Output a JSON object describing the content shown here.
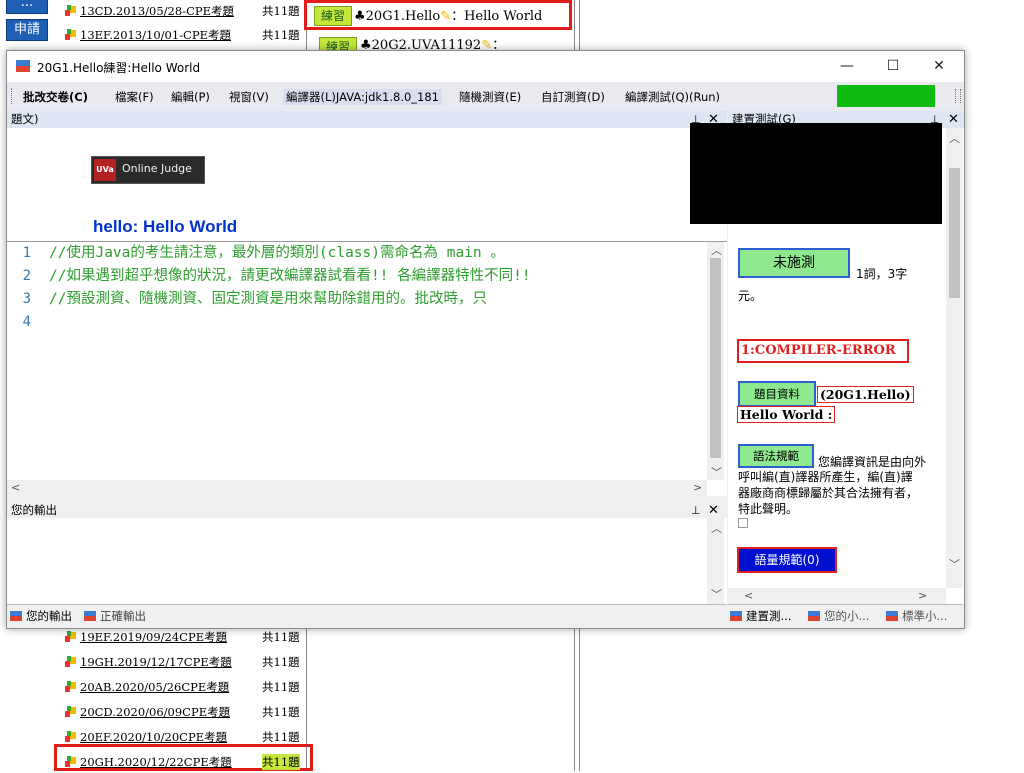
{
  "background": {
    "tags": [
      "...",
      "申請"
    ],
    "top_rows": [
      {
        "link": "13CD.2013/05/28-CPE考題",
        "count": "共11題"
      },
      {
        "link": "13EF.2013/10/01-CPE考題",
        "count": "共11題"
      }
    ],
    "practice_rows": [
      {
        "badge": "練習",
        "text": "20G1.Hello",
        "suffix": "：Hello World"
      },
      {
        "badge": "練習",
        "text": "20G2.UVA11192",
        "suffix": "："
      }
    ],
    "bottom_rows": [
      {
        "link": "19EF.2019/09/24CPE考題",
        "count": "共11題"
      },
      {
        "link": "19GH.2019/12/17CPE考題",
        "count": "共11題"
      },
      {
        "link": "20AB.2020/05/26CPE考題",
        "count": "共11題"
      },
      {
        "link": "20CD.2020/06/09CPE考題",
        "count": "共11題"
      },
      {
        "link": "20EF.2020/10/20CPE考題",
        "count": "共11題"
      },
      {
        "link": "20GH.2020/12/22CPE考題",
        "count": "共11題"
      }
    ]
  },
  "window": {
    "title": "20G1.Hello練習:Hello World",
    "controls": {
      "minimize": "—",
      "maximize": "☐",
      "close": "✕"
    }
  },
  "menu": {
    "items": [
      "批改交卷(C)",
      "檔案(F)",
      "編輯(P)",
      "視窗(V)",
      "編譯器(L)JAVA:jdk1.8.0_181",
      "隨機測資(E)",
      "自訂測資(D)",
      "編譯測試(Q)(Run)"
    ],
    "run_color": "#10bb10"
  },
  "problem_pane": {
    "header": "題文)",
    "logo_tag": "UVa",
    "logo_text": "Online Judge",
    "heading": "hello: Hello World"
  },
  "editor": {
    "line_numbers": [
      "1",
      "2",
      "3",
      "4"
    ],
    "lines": [
      "//使用Java的考生請注意，最外層的類別(class)需命名為 main 。",
      "//如果遇到超乎想像的狀況，請更改編譯器試看看!! 各編譯器特性不同!!",
      "//預設測資、隨機測資、固定測資是用來幫助除錯用的。批改時，只",
      ""
    ],
    "code_color": "#2e9e2e"
  },
  "output_pane": {
    "header": "您的輸出",
    "tabs": [
      "您的輸出",
      "正確輸出"
    ]
  },
  "right_panel": {
    "header": "建置測試(G)",
    "status_button": "未施測",
    "status_suffix": "1詞，3字",
    "status_suffix2": "元。",
    "error_label": "1:COMPILER-ERROR",
    "info_button": "題目資料",
    "info_id": "(20G1.Hello)",
    "info_title": "Hello World :",
    "syntax_button": "語法規範",
    "syntax_text": [
      "您編譯資訊是由向外",
      "呼叫編(直)譯器所產生，編(直)譯",
      "器廠商商標歸屬於其合法擁有者，",
      "特此聲明。"
    ],
    "quality_button": "語量規範(0)",
    "tabs": [
      "建置測...",
      "您的小...",
      "標準小..."
    ]
  }
}
